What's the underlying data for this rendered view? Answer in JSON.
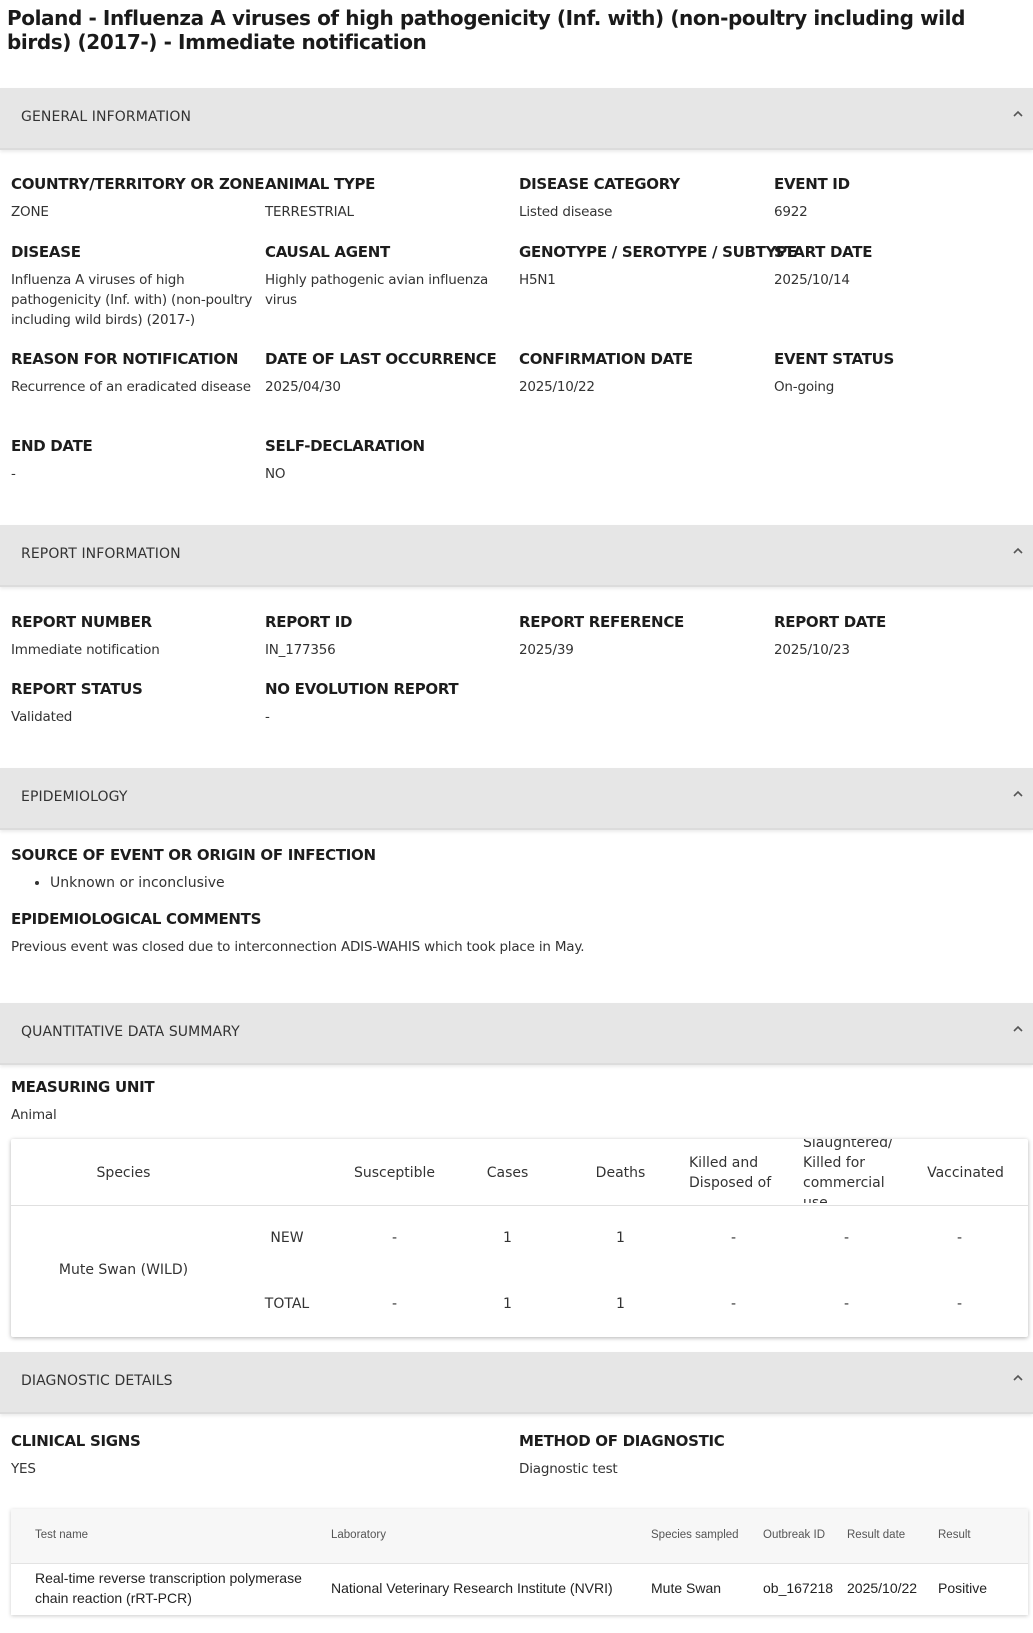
{
  "title": "Poland - Influenza A viruses of high pathogenicity (Inf. with) (non-poultry including wild birds) (2017-) - Immediate notification",
  "sections": {
    "general": "GENERAL INFORMATION",
    "report": "REPORT INFORMATION",
    "epidemiology": "EPIDEMIOLOGY",
    "quantitative": "QUANTITATIVE DATA SUMMARY",
    "diagnostic": "DIAGNOSTIC DETAILS"
  },
  "general_info": {
    "country_label": "COUNTRY/TERRITORY OR ZONE",
    "country_value": "ZONE",
    "animal_type_label": "ANIMAL TYPE",
    "animal_type_value": "TERRESTRIAL",
    "disease_category_label": "DISEASE CATEGORY",
    "disease_category_value": "Listed disease",
    "event_id_label": "EVENT ID",
    "event_id_value": "6922",
    "disease_label": "DISEASE",
    "disease_value": "Influenza A viruses of high pathogenicity (Inf. with) (non-poultry including wild birds) (2017-)",
    "causal_agent_label": "CAUSAL AGENT",
    "causal_agent_value": "Highly pathogenic avian influenza virus",
    "genotype_label": "GENOTYPE / SEROTYPE / SUBTYPE",
    "genotype_value": "H5N1",
    "start_date_label": "START DATE",
    "start_date_value": "2025/10/14",
    "reason_label": "REASON FOR NOTIFICATION",
    "reason_value": "Recurrence of an eradicated disease",
    "last_occurrence_label": "DATE OF LAST OCCURRENCE",
    "last_occurrence_value": "2025/04/30",
    "confirmation_label": "CONFIRMATION DATE",
    "confirmation_value": "2025/10/22",
    "event_status_label": "EVENT STATUS",
    "event_status_value": "On-going",
    "end_date_label": "END DATE",
    "end_date_value": "-",
    "self_declaration_label": "SELF-DECLARATION",
    "self_declaration_value": "NO"
  },
  "report_info": {
    "number_label": "REPORT NUMBER",
    "number_value": "Immediate notification",
    "id_label": "REPORT ID",
    "id_value": "IN_177356",
    "reference_label": "REPORT REFERENCE",
    "reference_value": "2025/39",
    "date_label": "REPORT DATE",
    "date_value": "2025/10/23",
    "status_label": "REPORT STATUS",
    "status_value": "Validated",
    "no_evolution_label": "NO EVOLUTION REPORT",
    "no_evolution_value": "-"
  },
  "epidemiology": {
    "source_label": "SOURCE OF EVENT OR ORIGIN OF INFECTION",
    "source_items": [
      "Unknown or inconclusive"
    ],
    "comments_label": "EPIDEMIOLOGICAL COMMENTS",
    "comments_value": "Previous event was closed due to interconnection ADIS-WAHIS which took place in May."
  },
  "quantitative": {
    "unit_label": "MEASURING UNIT",
    "unit_value": "Animal",
    "headers": {
      "species": "Species",
      "susceptible": "Susceptible",
      "cases": "Cases",
      "deaths": "Deaths",
      "killed": "Killed and Disposed of",
      "slaughtered": "Slaughtered/ Killed for commercial use",
      "vaccinated": "Vaccinated"
    },
    "species_name": "Mute Swan (WILD)",
    "rows": [
      {
        "label": "NEW",
        "susceptible": "-",
        "cases": "1",
        "deaths": "1",
        "killed": "-",
        "slaughtered": "-",
        "vaccinated": "-"
      },
      {
        "label": "TOTAL",
        "susceptible": "-",
        "cases": "1",
        "deaths": "1",
        "killed": "-",
        "slaughtered": "-",
        "vaccinated": "-"
      }
    ]
  },
  "diagnostic": {
    "clinical_label": "CLINICAL SIGNS",
    "clinical_value": "YES",
    "method_label": "METHOD OF DIAGNOSTIC",
    "method_value": "Diagnostic test",
    "headers": {
      "test_name": "Test name",
      "laboratory": "Laboratory",
      "species": "Species sampled",
      "outbreak": "Outbreak ID",
      "result_date": "Result date",
      "result": "Result"
    },
    "rows": [
      {
        "test_name": "Real-time reverse transcription polymerase chain reaction (rRT-PCR)",
        "laboratory": "National Veterinary Research Institute (NVRI)",
        "species": "Mute Swan",
        "outbreak": "ob_167218",
        "result_date": "2025/10/22",
        "result": "Positive"
      }
    ]
  }
}
